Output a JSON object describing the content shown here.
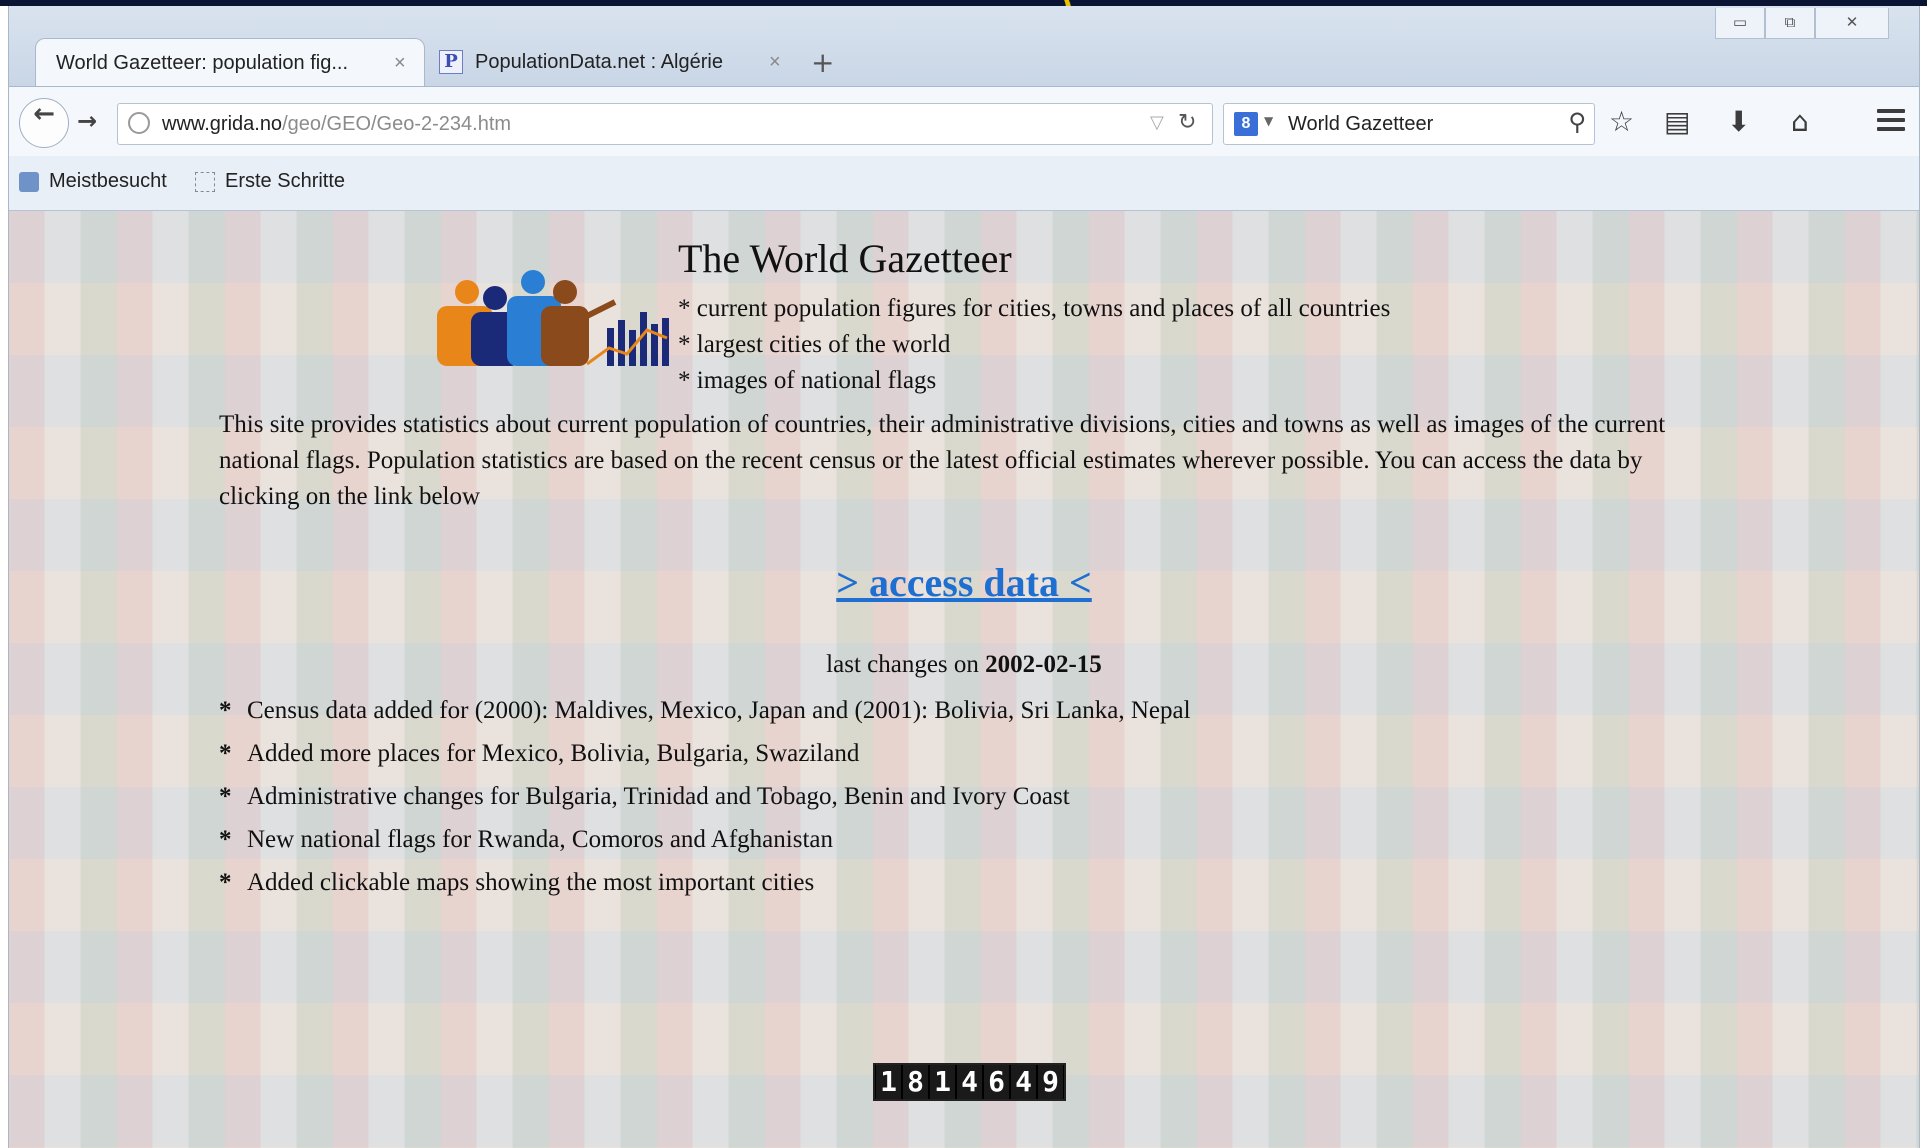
{
  "browser": {
    "tabs": [
      {
        "label": "World Gazetteer: population fig...",
        "active": true
      },
      {
        "label": "PopulationData.net : Algérie",
        "active": false
      }
    ],
    "tab_close_glyph": "×",
    "new_tab_glyph": "+",
    "url_domain": "www.grida.no",
    "url_path": "/geo/GEO/Geo-2-234.htm",
    "search_text": "World Gazetteer",
    "bookmarks": [
      "Meistbesucht",
      "Erste Schritte"
    ],
    "window_controls": [
      "▭",
      "⧉",
      "✕"
    ]
  },
  "page": {
    "title": "The World Gazetteer",
    "bullets": [
      "current population figures for cities, towns and places of all countries",
      "largest cities of the world",
      "images of national flags"
    ],
    "intro": "This site provides statistics about current population of countries, their administrative divisions, cities and towns as well as images of the current national flags. Population statistics are based on the recent census or the latest official estimates wherever possible. You can access the data by clicking on the link below",
    "access_link": "> access data <",
    "last_changes_label": "last changes on",
    "last_changes_date": "2002-02-15",
    "changes": [
      "Census data added for (2000): Maldives, Mexico, Japan and (2001): Bolivia, Sri Lanka, Nepal",
      "Added more places for Mexico, Bolivia, Bulgaria, Swaziland",
      "Administrative changes for Bulgaria, Trinidad and Tobago, Benin and Ivory Coast",
      "New national flags for Rwanda, Comoros and Afghanistan",
      "Added clickable maps showing the most important cities"
    ],
    "counter_digits": [
      "1",
      "8",
      "1",
      "4",
      "6",
      "4",
      "9"
    ]
  },
  "colors": {
    "link": "#1e6fd0",
    "chrome_bg": "#dde7f3"
  },
  "icons": [
    "back-arrow-icon",
    "forward-arrow-icon",
    "globe-icon",
    "reload-icon",
    "search-engine-icon",
    "magnifier-icon",
    "star-icon",
    "reading-list-icon",
    "download-icon",
    "home-icon",
    "menu-icon"
  ]
}
